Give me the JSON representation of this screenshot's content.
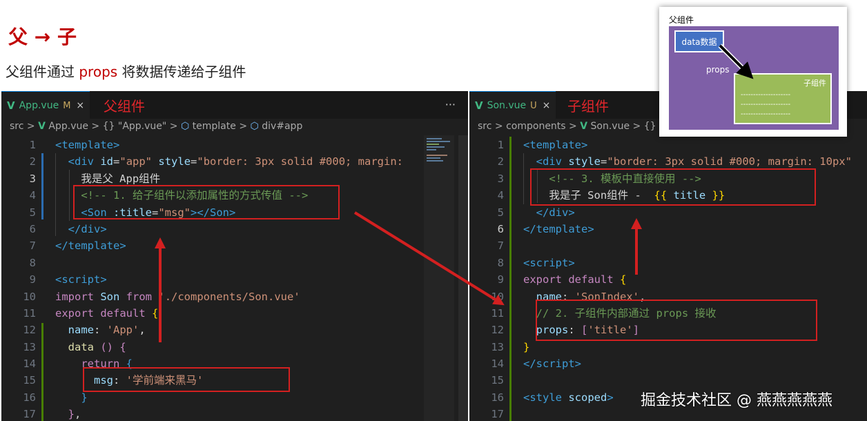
{
  "heading": "父 → 子",
  "subtitle": {
    "pre": "父组件通过 ",
    "highlight": "props",
    "post": " 将数据传递给子组件"
  },
  "left_editor": {
    "tab": {
      "name": "App.vue",
      "status": "M",
      "close": "×"
    },
    "more": "···",
    "annotation": "父组件",
    "breadcrumb": [
      "src",
      ">",
      "App.vue",
      ">",
      "{} \"App.vue\"",
      ">",
      "template",
      ">",
      "div#app"
    ]
  },
  "right_editor": {
    "tab": {
      "name": "Son.vue",
      "status": "U",
      "close": "×"
    },
    "annotation": "子组件",
    "breadcrumb": [
      "src",
      ">",
      "components",
      ">",
      "Son.vue",
      ">",
      "{} \"So"
    ]
  },
  "diagram": {
    "parent_label": "父组件",
    "data_label": "data数据",
    "props_label": "props",
    "child_label": "子组件",
    "dashes": "--------------------"
  },
  "watermark": "掘金技术社区 @ 燕燕燕燕燕",
  "colors": {
    "accent_red": "#c00000",
    "vue_green": "#41b883",
    "editor_bg": "#1f1f1f"
  }
}
